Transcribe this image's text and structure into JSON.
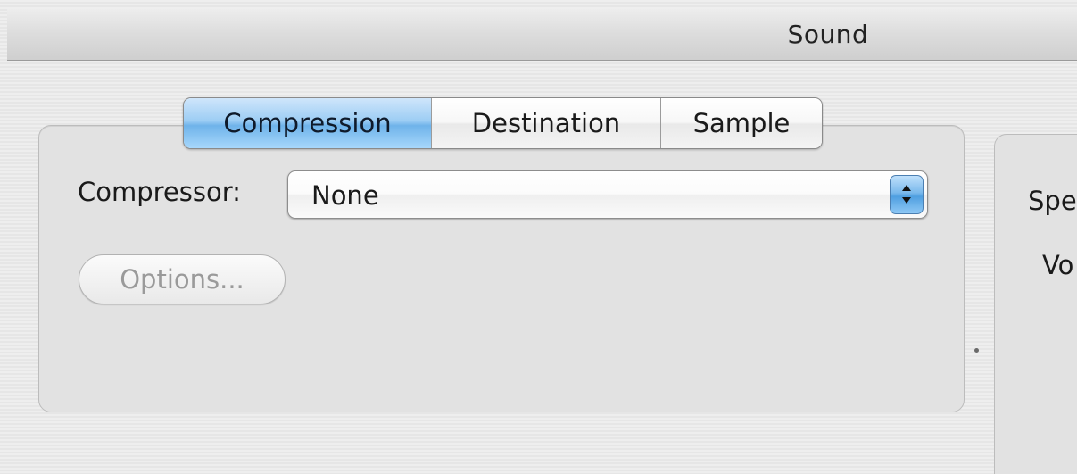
{
  "window": {
    "title": "Sound"
  },
  "tabs": [
    {
      "label": "Compression",
      "active": true
    },
    {
      "label": "Destination",
      "active": false
    },
    {
      "label": "Sample",
      "active": false
    }
  ],
  "compression": {
    "compressor_label": "Compressor:",
    "compressor_value": "None",
    "options_label": "Options...",
    "options_enabled": false
  },
  "right_panel": {
    "label_1": "Spe",
    "label_2": "Vo"
  },
  "colors": {
    "accent": "#7ab9ec",
    "panel_bg": "#e2e2e2",
    "disabled_text": "#9a9a9a"
  }
}
